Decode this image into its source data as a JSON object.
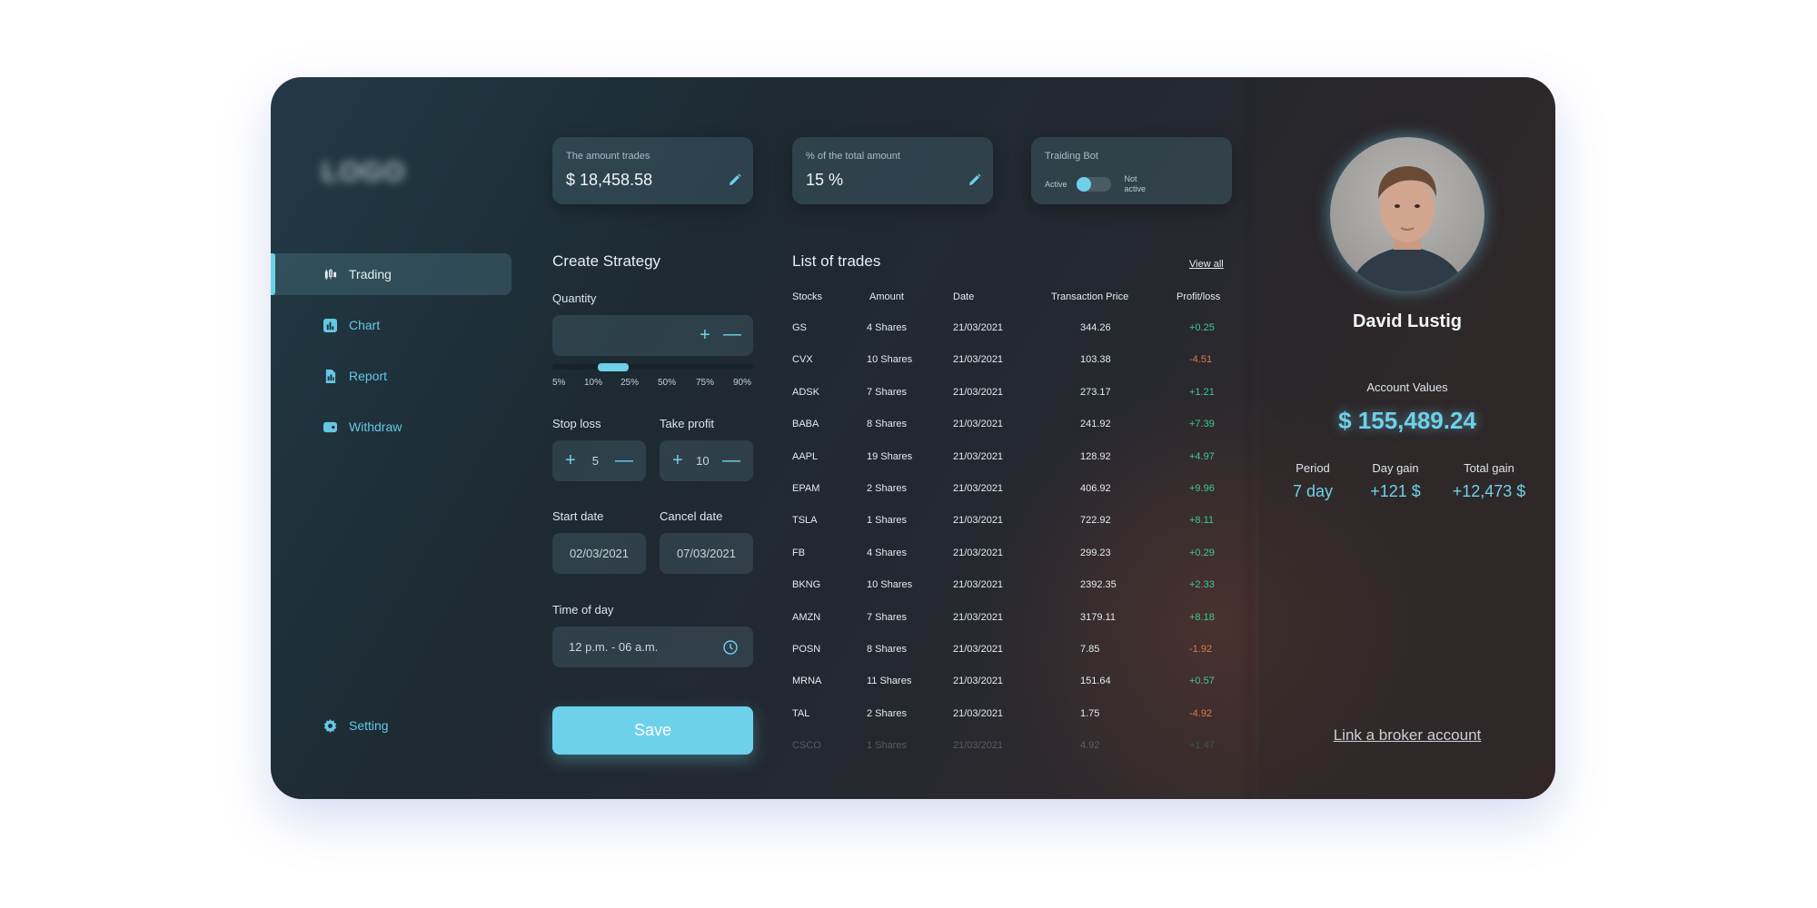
{
  "logo": "LOGO",
  "sidebar": {
    "items": [
      {
        "label": "Trading",
        "icon": "candlestick-icon",
        "active": true
      },
      {
        "label": "Chart",
        "icon": "bar-chart-icon",
        "active": false
      },
      {
        "label": "Report",
        "icon": "document-icon",
        "active": false
      },
      {
        "label": "Withdraw",
        "icon": "wallet-icon",
        "active": false
      }
    ],
    "setting_label": "Setting"
  },
  "cards": {
    "amount_trades": {
      "label": "The amount trades",
      "value": "$ 18,458.58"
    },
    "percent_total": {
      "label": "% of the total amount",
      "value": "15 %"
    },
    "trading_bot": {
      "label": "Traiding Bot",
      "active_label": "Active",
      "inactive_label": "Not active",
      "is_active": true
    }
  },
  "strategy": {
    "title": "Create Strategy",
    "quantity_label": "Quantity",
    "quantity_ticks": [
      "5%",
      "10%",
      "25%",
      "50%",
      "75%",
      "90%"
    ],
    "quantity_selected": "10%",
    "stop_loss_label": "Stop loss",
    "stop_loss_value": "5",
    "take_profit_label": "Take profit",
    "take_profit_value": "10",
    "start_date_label": "Start date",
    "start_date_value": "02/03/2021",
    "cancel_date_label": "Cancel date",
    "cancel_date_value": "07/03/2021",
    "time_label": "Time of day",
    "time_value": "12 p.m. - 06 a.m.",
    "save_label": "Save"
  },
  "trades": {
    "title": "List of trades",
    "view_all": "View all",
    "columns": [
      "Stocks",
      "Amount",
      "Date",
      "Transaction Price",
      "Profit/loss"
    ],
    "rows": [
      {
        "stock": "GS",
        "amount": "4 Shares",
        "date": "21/03/2021",
        "price": "344.26",
        "pl": "+0.25"
      },
      {
        "stock": "CVX",
        "amount": "10 Shares",
        "date": "21/03/2021",
        "price": "103.38",
        "pl": "-4.51"
      },
      {
        "stock": "ADSK",
        "amount": "7 Shares",
        "date": "21/03/2021",
        "price": "273.17",
        "pl": "+1.21"
      },
      {
        "stock": "BABA",
        "amount": "8 Shares",
        "date": "21/03/2021",
        "price": "241.92",
        "pl": "+7.39"
      },
      {
        "stock": "AAPL",
        "amount": "19 Shares",
        "date": "21/03/2021",
        "price": "128.92",
        "pl": "+4.97"
      },
      {
        "stock": "EPAM",
        "amount": "2 Shares",
        "date": "21/03/2021",
        "price": "406.92",
        "pl": "+9.96"
      },
      {
        "stock": "TSLA",
        "amount": "1 Shares",
        "date": "21/03/2021",
        "price": "722.92",
        "pl": "+8.11"
      },
      {
        "stock": "FB",
        "amount": "4 Shares",
        "date": "21/03/2021",
        "price": "299.23",
        "pl": "+0.29"
      },
      {
        "stock": "BKNG",
        "amount": "10 Shares",
        "date": "21/03/2021",
        "price": "2392.35",
        "pl": "+2.33"
      },
      {
        "stock": "AMZN",
        "amount": "7 Shares",
        "date": "21/03/2021",
        "price": "3179.11",
        "pl": "+8.18"
      },
      {
        "stock": "POSN",
        "amount": "8 Shares",
        "date": "21/03/2021",
        "price": "7.85",
        "pl": "-1.92"
      },
      {
        "stock": "MRNA",
        "amount": "11 Shares",
        "date": "21/03/2021",
        "price": "151.64",
        "pl": "+0.57"
      },
      {
        "stock": "TAL",
        "amount": "2 Shares",
        "date": "21/03/2021",
        "price": "1.75",
        "pl": "-4.92"
      },
      {
        "stock": "CSCO",
        "amount": "1 Shares",
        "date": "21/03/2021",
        "price": "4.92",
        "pl": "+1.47"
      }
    ]
  },
  "profile": {
    "name": "David Lustig",
    "account_label": "Account Values",
    "account_value": "$ 155,489.24",
    "period_label": "Period",
    "period_value": "7 day",
    "day_gain_label": "Day gain",
    "day_gain_value": "+121 $",
    "total_gain_label": "Total gain",
    "total_gain_value": "+12,473 $",
    "broker_link": "Link a broker account"
  },
  "colors": {
    "accent": "#6fd0ea",
    "profit": "#3fc98c",
    "loss": "#e0754c"
  }
}
